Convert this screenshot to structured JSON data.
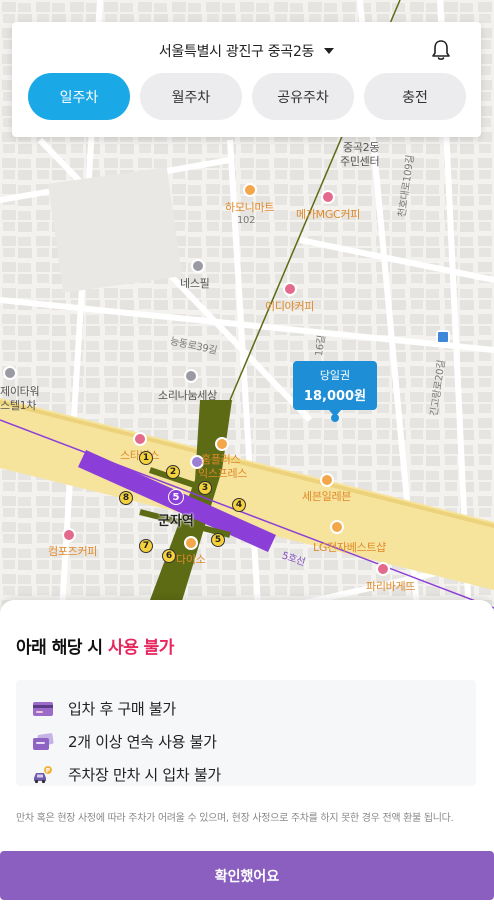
{
  "header": {
    "location": "서울특별시 광진구 중곡2동",
    "tabs": [
      {
        "label": "일주차",
        "active": true
      },
      {
        "label": "월주차",
        "active": false
      },
      {
        "label": "공유주차",
        "active": false
      },
      {
        "label": "충전",
        "active": false
      }
    ]
  },
  "map": {
    "labels": {
      "hamoni": "하모니마트",
      "bldg102": "102",
      "megacoffee": "메가MGC커피",
      "nesspil": "네스필",
      "ediya": "이디야커피",
      "junggok2_l1": "중곡2동",
      "junggok2_l2": "주민센터",
      "neunghwa39": "능동로39길",
      "sori": "소리나눔세상",
      "hompl_l1": "홈플러스",
      "hompl_l2": "익스프레스",
      "starbucks": "스타벅스",
      "seven": "세븐일레븐",
      "gunja": "군자역",
      "lg": "LG전자베스트샵",
      "line5": "5호선",
      "compose": "컴포즈커피",
      "daiso": "다이소",
      "paris": "파리바게뜨",
      "jetower_l1": "제이타워",
      "jetower_l2": "스텔1차",
      "chunho109": "천호대로109길",
      "road16": "16길",
      "road20": "긴고랑로20길"
    },
    "price_tag": {
      "label": "당일권",
      "price": "18,000원"
    },
    "line5_badge": "5",
    "exits": [
      "1",
      "2",
      "3",
      "4",
      "5",
      "6",
      "7",
      "8"
    ],
    "colors": {
      "line5": "#8c3fd8",
      "road_main": "#f7e59e",
      "line7": "#5d6b14"
    }
  },
  "sheet": {
    "title_prefix": "아래 해당 시 ",
    "title_highlight": "사용 불가",
    "rules": [
      {
        "icon": "credit-card-icon",
        "text": "입차 후 구매 불가"
      },
      {
        "icon": "tickets-icon",
        "text": "2개 이상 연속 사용 불가"
      },
      {
        "icon": "car-parking-icon",
        "text": "주차장 만차 시 입차 불가"
      }
    ],
    "note": "만차 혹은 현장 사정에 따라 주차가 어려울 수 있으며, 현장 사정으로 주차를 하지 못한 경우 전액 환불 됩니다.",
    "confirm_label": "확인했어요"
  }
}
